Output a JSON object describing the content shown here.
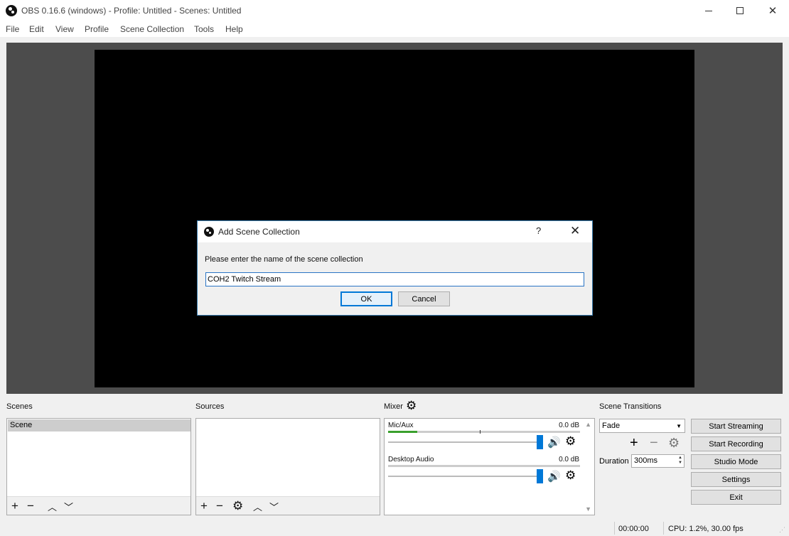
{
  "window": {
    "title": "OBS 0.16.6 (windows) - Profile: Untitled - Scenes: Untitled"
  },
  "menu": [
    "File",
    "Edit",
    "View",
    "Profile",
    "Scene Collection",
    "Tools",
    "Help"
  ],
  "dialog": {
    "title": "Add Scene Collection",
    "help": "?",
    "close": "✕",
    "prompt": "Please enter the name of the scene collection",
    "input_value": "COH2 Twitch Stream",
    "ok_label": "OK",
    "cancel_label": "Cancel"
  },
  "docks": {
    "scenes_label": "Scenes",
    "sources_label": "Sources",
    "mixer_label": "Mixer",
    "transitions_label": "Scene Transitions"
  },
  "scenes": {
    "items": [
      "Scene"
    ]
  },
  "mixer": {
    "channels": [
      {
        "name": "Mic/Aux",
        "db": "0.0 dB",
        "level": 0.15,
        "volume": 1.0
      },
      {
        "name": "Desktop Audio",
        "db": "0.0 dB",
        "level": 0.0,
        "volume": 1.0
      }
    ]
  },
  "transitions": {
    "selected": "Fade",
    "duration_label": "Duration",
    "duration_value": "300ms"
  },
  "controls": {
    "start_streaming": "Start Streaming",
    "start_recording": "Start Recording",
    "studio_mode": "Studio Mode",
    "settings": "Settings",
    "exit": "Exit"
  },
  "status": {
    "time": "00:00:00",
    "cpu": "CPU: 1.2%, 30.00 fps"
  },
  "colors": {
    "accent": "#0078d7",
    "meter_green": "#3aa02d",
    "preview_bg": "#000000",
    "preview_border": "#4c4c4c"
  }
}
